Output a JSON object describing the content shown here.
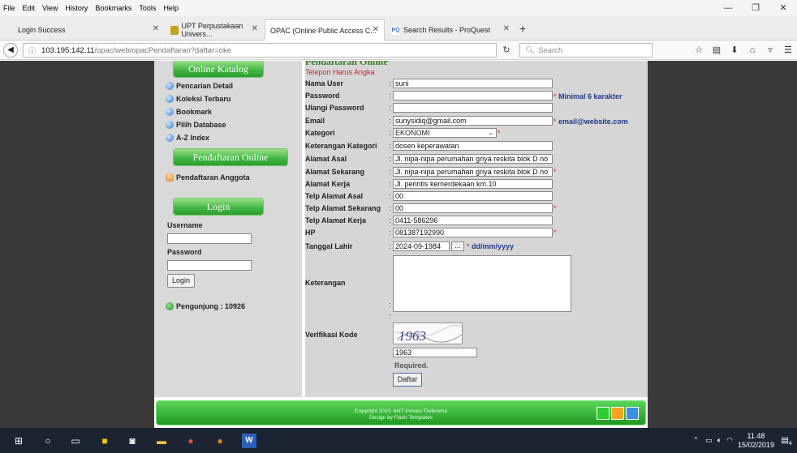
{
  "menu": [
    "File",
    "Edit",
    "View",
    "History",
    "Bookmarks",
    "Tools",
    "Help"
  ],
  "window_controls": {
    "minimize": "—",
    "maximize": "❐",
    "close": "✕"
  },
  "tabs": [
    {
      "label": "Login Success",
      "active": false
    },
    {
      "label": "UPT Perpustakaan Univers...",
      "active": false
    },
    {
      "label": "OPAC (Online Public Access C...",
      "active": true
    },
    {
      "label": "Search Results - ProQuest",
      "active": false
    }
  ],
  "tab_new": "+",
  "url": {
    "host": "103.195.142.11",
    "path": "/opac/web/opacPendaftaran?daftar=oke"
  },
  "search": {
    "placeholder": "Search"
  },
  "sidebar": {
    "online_katalog": "Online Katalog",
    "links": [
      "Pencarian Detail",
      "Koleksi Terbaru",
      "Bookmark",
      "Pilih Database",
      "A-Z Index"
    ],
    "pendaftaran_title": "Pendaftaran Online",
    "pendaftaran_link": "Pendaftaran Anggota",
    "login_title": "Login",
    "username_label": "Username",
    "password_label": "Password",
    "login_button": "Login",
    "visitors": "Pengunjung : 10926"
  },
  "form": {
    "title": "Pendaftaran Online",
    "subtitle": "Telepon Harus Angka",
    "colon": ":",
    "labels": {
      "nama_user": "Nama User",
      "password": "Password",
      "ulangi_password": "Ulangi Password",
      "email": "Email",
      "kategori": "Kategori",
      "keterangan_kategori": "Keterangan Kategori",
      "alamat_asal": "Alamat Asal",
      "alamat_sekarang": "Alamat Sekarang",
      "alamat_kerja": "Alamat Kerja",
      "telp_alamat_asal": "Telp Alamat Asal",
      "telp_alamat_sekarang": "Telp Alamat Sekarang",
      "telp_alamat_kerja": "Telp Alamat Kerja",
      "hp": "HP",
      "tanggal_lahir": "Tanggal Lahir",
      "keterangan": "Keterangan",
      "verifikasi_kode": "Verifikasi Kode"
    },
    "values": {
      "nama_user": "suni",
      "password": "",
      "ulangi_password": "",
      "email": "sunysidiq@gmail.com",
      "kategori": "EKONOMI",
      "keterangan_kategori": "dosen keperawatan",
      "alamat_asal": "Jl. nipa-nipa perumahan griya reskita blok D no",
      "alamat_sekarang": "Jl. nipa-nipa perumahan griya reskita blok D no",
      "alamat_kerja": "Jl. perintis kemerdekaan km.10",
      "telp_alamat_asal": "00",
      "telp_alamat_sekarang": "00",
      "telp_alamat_kerja": "0411-586296",
      "hp": "081387192990",
      "tanggal_lahir": "2024-09-1984",
      "verifikasi_kode": "1963"
    },
    "hints": {
      "password": "Minimal 6 karakter",
      "email": "email@website.com",
      "date_format": "dd/mm/yyyy"
    },
    "required_mark": "*",
    "date_button": "...",
    "captcha_text": "1963",
    "required_text": "Required.",
    "submit": "Daftar"
  },
  "footer": {
    "line1": "Copyright 2010. beIT Inovasi Tiwikrama",
    "line2": "Design by Flash Templates",
    "squares": [
      "#2ecc2e",
      "#f5a623",
      "#3a8fe0"
    ]
  },
  "taskbar": {
    "time": "11.48",
    "date": "15/02/2019",
    "notification_count": "4"
  }
}
